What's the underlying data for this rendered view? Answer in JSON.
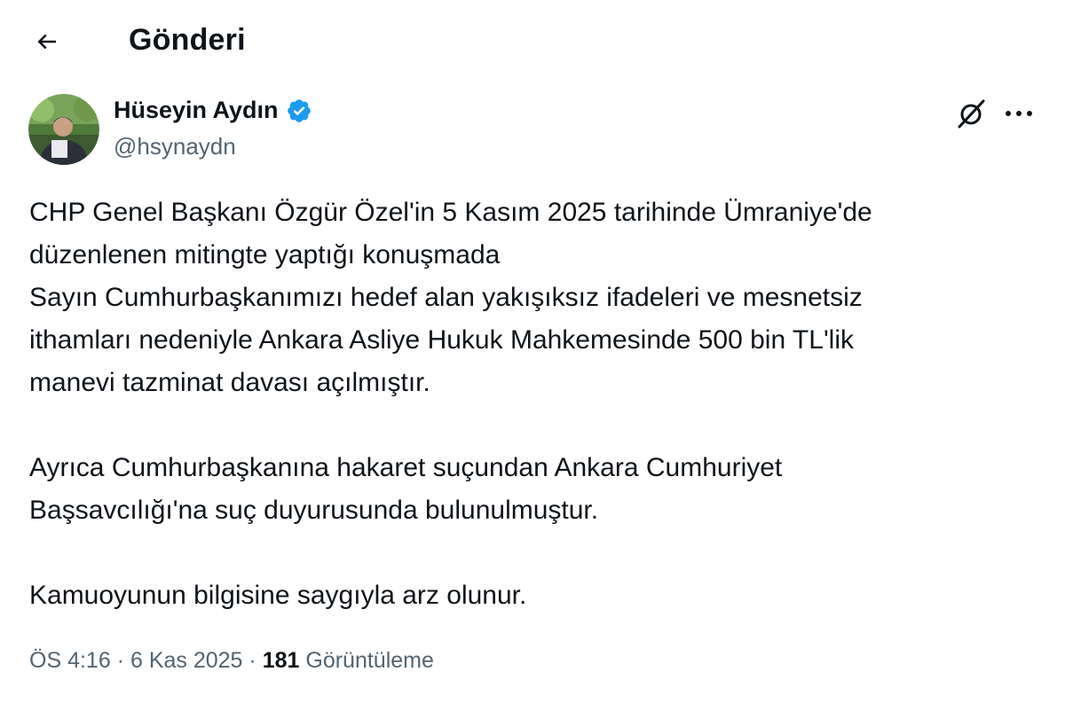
{
  "header": {
    "title": "Gönderi"
  },
  "author": {
    "name": "Hüseyin Aydın",
    "handle": "@hsynaydn",
    "verified": true
  },
  "tweet": {
    "lines": [
      "CHP Genel Başkanı Özgür Özel'in 5 Kasım 2025 tarihinde   Ümraniye'de",
      "düzenlenen mitingte yaptığı konuşmada",
      "Sayın Cumhurbaşkanımızı hedef alan yakışıksız ifadeleri ve mesnetsiz",
      "ithamları nedeniyle Ankara Asliye Hukuk Mahkemesinde 500 bin TL'lik",
      "manevi tazminat davası açılmıştır.",
      "Ayrıca Cumhurbaşkanına hakaret suçundan Ankara Cumhuriyet",
      "Başsavcılığı'na suç duyurusunda bulunulmuştur.",
      "Kamuoyunun bilgisine saygıyla arz olunur."
    ]
  },
  "meta": {
    "time": "ÖS 4:16",
    "separator": "·",
    "date": "6 Kas 2025",
    "views_count": "181",
    "views_label": "Görüntüleme"
  },
  "icons": {
    "back": "arrow-left-icon",
    "verified": "verified-badge-icon",
    "grok": "grok-icon",
    "more": "more-horizontal-icon"
  },
  "colors": {
    "text_primary": "#0f1419",
    "text_secondary": "#536471",
    "verified_blue": "#1d9bf0"
  }
}
